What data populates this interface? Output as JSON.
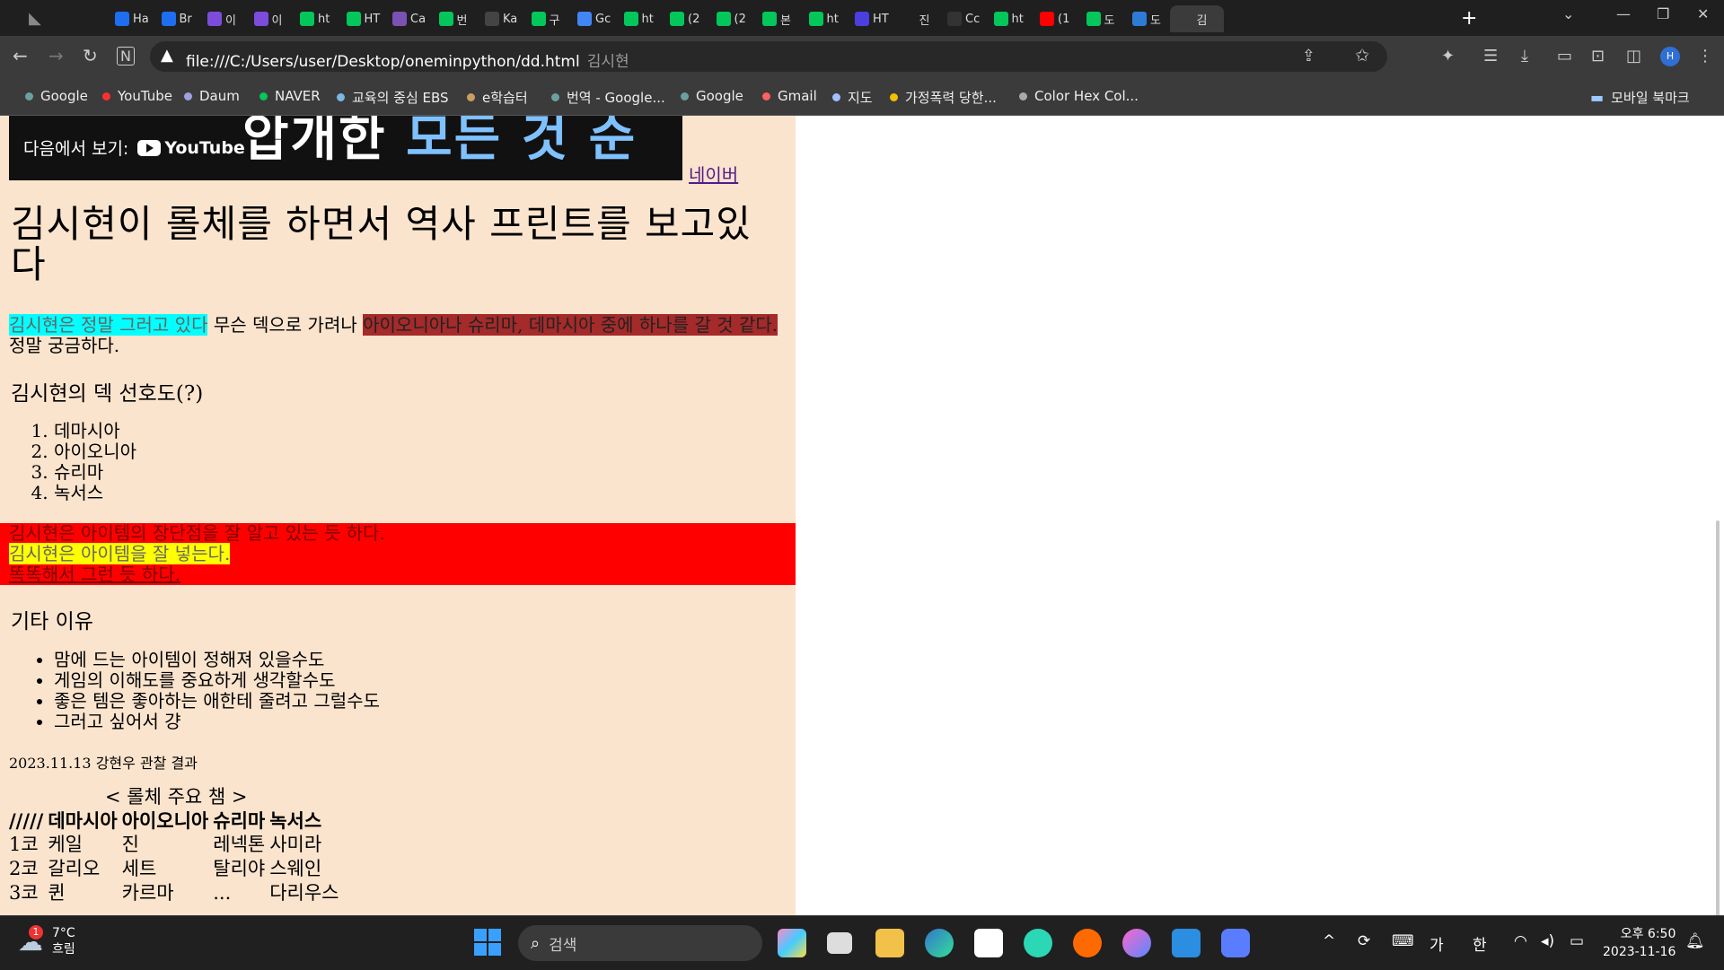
{
  "tabs": [
    {
      "label": "Ha",
      "icon": "b-icon",
      "color": "#1e6ef0"
    },
    {
      "label": "Br",
      "icon": "b-icon",
      "color": "#1e6ef0"
    },
    {
      "label": "이",
      "icon": "ai-icon",
      "color": "#7d4cdb"
    },
    {
      "label": "이",
      "icon": "ai-icon",
      "color": "#7d4cdb"
    },
    {
      "label": "ht",
      "icon": "naver-icon",
      "color": "#03c75a"
    },
    {
      "label": "HT",
      "icon": "blog-icon",
      "color": "#03c75a"
    },
    {
      "label": "Ca",
      "icon": "bootstrap-icon",
      "color": "#7952b3"
    },
    {
      "label": "번",
      "icon": "naver-icon",
      "color": "#03c75a"
    },
    {
      "label": "Ka",
      "icon": "kakao-icon",
      "color": "#444"
    },
    {
      "label": "구",
      "icon": "naver-icon",
      "color": "#03c75a"
    },
    {
      "label": "Gc",
      "icon": "translate-icon",
      "color": "#4285f4"
    },
    {
      "label": "ht",
      "icon": "naver-icon",
      "color": "#03c75a"
    },
    {
      "label": "(2",
      "icon": "blog-icon",
      "color": "#03c75a"
    },
    {
      "label": "(2",
      "icon": "blog-icon",
      "color": "#03c75a"
    },
    {
      "label": "본",
      "icon": "naver-book-icon",
      "color": "#03c75a"
    },
    {
      "label": "ht",
      "icon": "naver-icon",
      "color": "#03c75a"
    },
    {
      "label": "HT",
      "icon": "react-icon",
      "color": "#4b3fe0"
    },
    {
      "label": "진",
      "icon": "circle-icon",
      "color": "#1f1f1f"
    },
    {
      "label": "Cc",
      "icon": "github-icon",
      "color": "#333"
    },
    {
      "label": "ht",
      "icon": "naver-icon",
      "color": "#03c75a"
    },
    {
      "label": "(1",
      "icon": "youtube-icon",
      "color": "#ff0000"
    },
    {
      "label": "도",
      "icon": "naver-icon",
      "color": "#03c75a"
    },
    {
      "label": "도",
      "icon": "tool-icon",
      "color": "#2e7bd6"
    },
    {
      "label": "김",
      "icon": "circle-icon",
      "color": "#3b3b3b",
      "active": true
    }
  ],
  "omnibox": {
    "url": "file:///C:/Users/user/Desktop/oneminpython/dd.html",
    "title": "김시현"
  },
  "bookmarks": [
    {
      "label": "Google",
      "color": "#6aa0a0"
    },
    {
      "label": "YouTube",
      "color": "#ff3030"
    },
    {
      "label": "Daum",
      "color": "#a0a0e0"
    },
    {
      "label": "NAVER",
      "color": "#03c75a"
    },
    {
      "label": "교육의 중심 EBS",
      "color": "#7ab8e0"
    },
    {
      "label": "e학습터",
      "color": "#c9a060"
    },
    {
      "label": "번역 - Google...",
      "color": "#6aa0a0"
    },
    {
      "label": "Google",
      "color": "#6aa0a0"
    },
    {
      "label": "Gmail",
      "color": "#ff6060"
    },
    {
      "label": "지도",
      "color": "#a0c0ff"
    },
    {
      "label": "가정폭력 당한...",
      "color": "#f5c000"
    },
    {
      "label": "Color Hex Col...",
      "color": "#aaaaaa"
    }
  ],
  "mobile_bookmarks": "모바일 북마크",
  "page": {
    "youtube": {
      "watch_on": "다음에서 보기:",
      "logo": "YouTube",
      "banner_text": "개한 모든 것 순",
      "banner_accent": "모든 것 순"
    },
    "naver_link": "네이버",
    "heading": "김시현이 롤체를 하면서 역사 프린트를 보고있다",
    "para_part1": "김시현은 정말 그러고 있다",
    "para_part2": " 무슨 덱으로 가려나 ",
    "para_part3": "아이오니아나 슈리마, 데마시아 중에 하나를 갈 것 같다.",
    "para_part4": "정말 궁금하다.",
    "deck_title": "김시현의 덱 선호도(?)",
    "deck_list": [
      "데마시아",
      "아이오니아",
      "슈리마",
      "녹서스"
    ],
    "red_line1": "김시현은 아이템의 장단점을 잘 알고 있는 듯 하다.",
    "red_line2": "김시현은 아이템을 잘 넣는다.",
    "red_line3": "똑똑해서 그런 듯 하다.",
    "other_title": "기타 이유",
    "other_list": [
      "맘에 드는 아이템이 정해져 있을수도",
      "게임의 이해도를 중요하게 생각할수도",
      "좋은 템은 좋아하는 애한테 줄려고 그럴수도",
      "그러고 싶어서 걍"
    ],
    "date_note": "2023.11.13 강현우 관찰 결과",
    "table": {
      "caption": "< 롤체 주요 챔 >",
      "headers": [
        "/////",
        "데마시아",
        "아이오니아",
        "슈리마",
        "녹서스"
      ],
      "rows": [
        [
          "1코",
          "케일",
          "진",
          "레넥톤",
          "사미라"
        ],
        [
          "2코",
          "갈리오",
          "세트",
          "탈리야",
          "스웨인"
        ],
        [
          "3코",
          "퀸",
          "카르마",
          "...",
          "다리우스"
        ]
      ]
    }
  },
  "taskbar": {
    "weather_temp": "7°C",
    "weather_desc": "흐림",
    "weather_badge": "1",
    "search_placeholder": "검색",
    "ime1": "가",
    "ime2": "한",
    "time": "오후 6:50",
    "date": "2023-11-16"
  }
}
